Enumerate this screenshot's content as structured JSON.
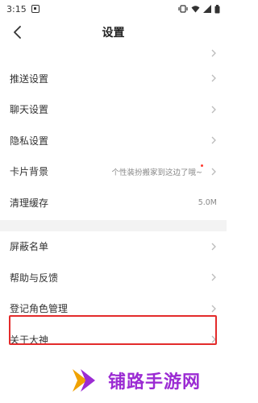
{
  "status": {
    "time": "3:15"
  },
  "nav": {
    "title": "设置"
  },
  "rows": [
    {
      "label": "推送设置"
    },
    {
      "label": "聊天设置"
    },
    {
      "label": "隐私设置"
    },
    {
      "label": "卡片背景",
      "value": "个性装扮搬家到这边了哦~"
    },
    {
      "label": "清理缓存",
      "value": "5.0M"
    },
    {
      "label": "屏蔽名单"
    },
    {
      "label": "帮助与反馈"
    },
    {
      "label": "登记角色管理"
    },
    {
      "label": "关于大神"
    }
  ],
  "watermark": {
    "text": "铺路手游网"
  },
  "colors": {
    "highlight": "#e32b2b",
    "watermark": "#9b2bd3",
    "dot": "#ff3b30"
  }
}
